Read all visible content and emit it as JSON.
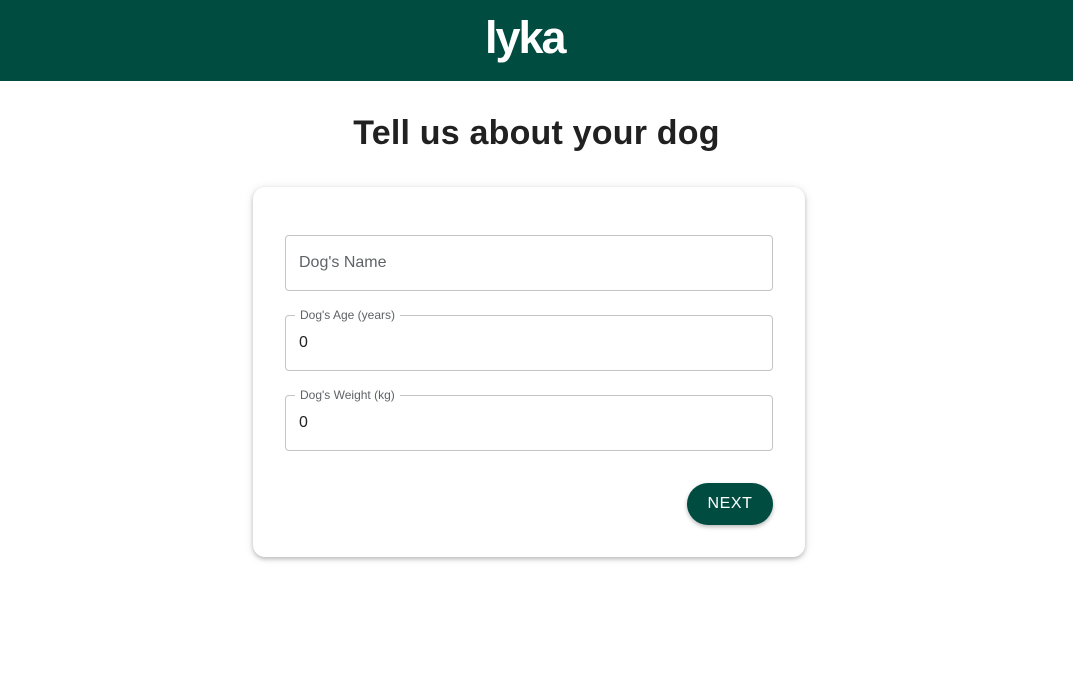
{
  "header": {
    "logo_text": "lyka",
    "background_color": "#004c40"
  },
  "page": {
    "title": "Tell us about your dog"
  },
  "form": {
    "name_field": {
      "placeholder": "Dog's Name",
      "value": ""
    },
    "age_field": {
      "label": "Dog's Age (years)",
      "value": "0"
    },
    "weight_field": {
      "label": "Dog's Weight (kg)",
      "value": "0"
    },
    "next_label": "NEXT",
    "accent_color": "#004c40"
  }
}
